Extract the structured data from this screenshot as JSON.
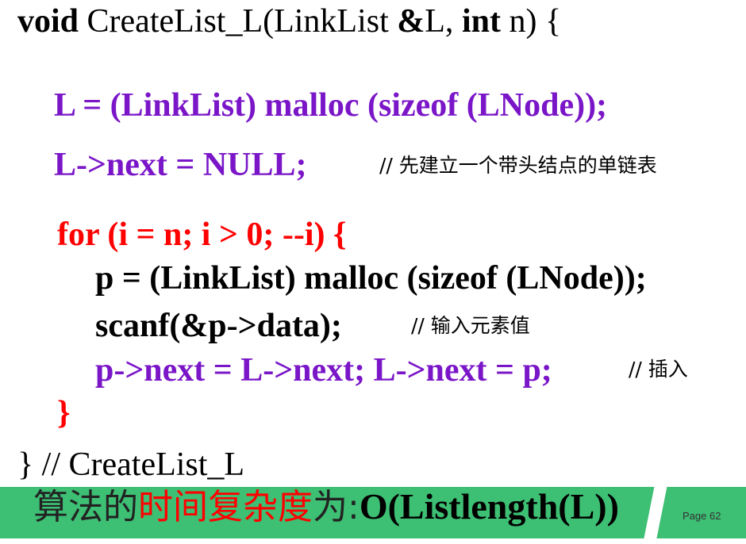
{
  "code": {
    "sig": {
      "void": "void",
      "name": " CreateList_L(LinkList ",
      "amp": "&",
      "param1": "L, ",
      "int": "int",
      "param2": " n) {"
    },
    "line1": "L = (LinkList) malloc (sizeof (LNode));",
    "line2": "L->next = NULL;",
    "comment2": "// 先建立一个带头结点的单链表",
    "line3": "for (i = n; i > 0; --i) {",
    "line4": "p = (LinkList) malloc (sizeof (LNode));",
    "line5": "scanf(&p->data);",
    "comment5": "// 输入元素值",
    "line6": "p->next = L->next; L->next = p;",
    "comment6": "// 插入",
    "line7": "}",
    "line8": "} // CreateList_L"
  },
  "footer": {
    "prefix": "算法的",
    "highlight": "时间复杂度",
    "suffix": "为:",
    "formula": "O(Listlength(L))",
    "page": "Page 62"
  },
  "colors": {
    "purple": "#7a16c8",
    "red": "#ff0000",
    "footer_bg": "#3dbf74"
  }
}
